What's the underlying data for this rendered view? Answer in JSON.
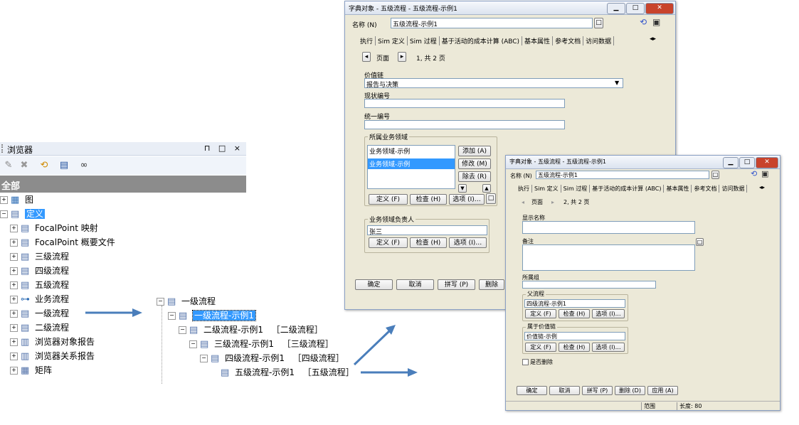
{
  "browser": {
    "title": "浏览器",
    "title_buttons": "⊓ □ ×",
    "all_label": "全部",
    "tree": [
      {
        "label": "图",
        "icon": "chart-icon"
      },
      {
        "label": "定义",
        "icon": "folder-doc-icon",
        "selected": true
      },
      {
        "label": "FocalPoint 映射",
        "icon": "doc-icon"
      },
      {
        "label": "FocalPoint 概要文件",
        "icon": "doc-icon"
      },
      {
        "label": "三级流程",
        "icon": "doc-icon"
      },
      {
        "label": "四级流程",
        "icon": "doc-icon"
      },
      {
        "label": "五级流程",
        "icon": "doc-icon"
      },
      {
        "label": "业务流程",
        "icon": "flow-icon"
      },
      {
        "label": "一级流程",
        "icon": "doc-icon"
      },
      {
        "label": "二级流程",
        "icon": "doc-icon"
      },
      {
        "label": "浏览器对象报告",
        "icon": "report-icon"
      },
      {
        "label": "浏览器关系报告",
        "icon": "report-icon"
      },
      {
        "label": "矩阵",
        "icon": "grid-icon"
      }
    ]
  },
  "mid_tree": [
    {
      "label": "一级流程",
      "type": "",
      "selected": false
    },
    {
      "label": "一级流程-示例1",
      "type": "",
      "selected": true
    },
    {
      "label": "二级流程-示例1",
      "type": "［二级流程］"
    },
    {
      "label": "三级流程-示例1",
      "type": "［三级流程］"
    },
    {
      "label": "四级流程-示例1",
      "type": "［四级流程］"
    },
    {
      "label": "五级流程-示例1",
      "type": "［五级流程］"
    }
  ],
  "dialog1": {
    "title": "字典对象 - 五级流程 - 五级流程-示例1",
    "name_label": "名称 (N)",
    "name_value": "五级流程-示例1",
    "tabs": [
      "执行",
      "Sim 定义",
      "Sim 过程",
      "基于活动的成本计算 (ABC)",
      "基本属性",
      "参考文档",
      "访问数据"
    ],
    "page_label": "页面",
    "page_info": "1, 共 2 页",
    "value_chain_label": "价值链",
    "value_chain_value": "报告与决策",
    "current_no_label": "现状编号",
    "unified_no_label": "统一编号",
    "domain_group": "所属业务领域",
    "domain_items": [
      "业务领域-示例",
      "业务领域-示例"
    ],
    "add_btn": "添加 (A)",
    "edit_btn": "修改 (M)",
    "remove_btn": "除去 (R)",
    "def_btn": "定义 (F)",
    "check_btn": "检查 (H)",
    "opt_btn": "选项 (I)…",
    "owner_group": "业务领域负责人",
    "owner_value": "张三",
    "ok_btn": "确定",
    "cancel_btn": "取消",
    "spell_btn": "拼写 (P)",
    "delete_btn": "删除"
  },
  "dialog2": {
    "title": "字典对象 - 五级流程 - 五级流程-示例1",
    "name_label": "名称 (N)",
    "name_value": "五级流程-示例1",
    "tabs": [
      "执行",
      "Sim 定义",
      "Sim 过程",
      "基于活动的成本计算 (ABC)",
      "基本属性",
      "参考文档",
      "访问数据"
    ],
    "page_label": "页面",
    "page_info": "2, 共 2 页",
    "display_name_label": "显示名称",
    "remark_label": "备注",
    "group_label": "所属组",
    "parent_group": "父流程",
    "parent_value": "四级流程-示例1",
    "valuechain_group": "属于价值链",
    "valuechain_value": "价值链-示例",
    "def_btn": "定义 (F)",
    "check_btn": "检查 (H)",
    "opt_btn": "选项 (I)…",
    "is_deleted_label": "是否删除",
    "ok_btn": "确定",
    "cancel_btn": "取消",
    "spell_btn": "拼写 (P)",
    "delete_btn": "删除 (D)",
    "apply_btn": "应用 (A)",
    "status_range": "范围",
    "status_length": "长度: 80"
  },
  "colors": {
    "selection": "#3399ff",
    "arrow": "#4a7ebb",
    "dialog_bg": "#ece9d8"
  }
}
